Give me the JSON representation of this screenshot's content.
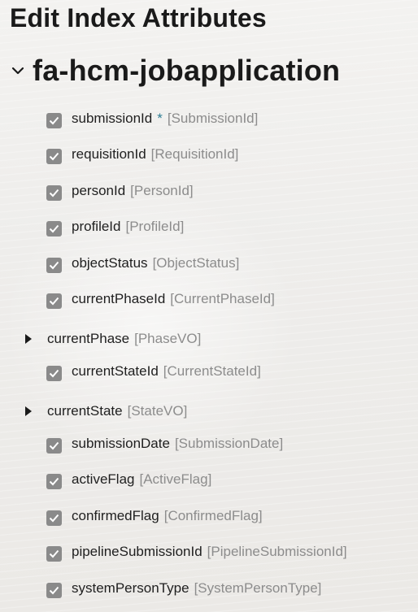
{
  "page": {
    "title": "Edit Index Attributes"
  },
  "group": {
    "name": "fa-hcm-jobapplication",
    "expanded": true
  },
  "colors": {
    "checkbox_fill": "#8a8a8a",
    "required_marker": "#2d7d93",
    "type_text": "#8c8c8c"
  },
  "attributes": [
    {
      "name": "submissionId",
      "required_mark": "*",
      "type": "[SubmissionId]",
      "checked": true
    },
    {
      "name": "requisitionId",
      "type": "[RequisitionId]",
      "checked": true
    },
    {
      "name": "personId",
      "type": "[PersonId]",
      "checked": true
    },
    {
      "name": "profileId",
      "type": "[ProfileId]",
      "checked": true
    },
    {
      "name": "objectStatus",
      "type": "[ObjectStatus]",
      "checked": true
    },
    {
      "name": "currentPhaseId",
      "type": "[CurrentPhaseId]",
      "checked": true
    },
    {
      "name": "currentStateId",
      "type": "[CurrentStateId]",
      "checked": true
    },
    {
      "name": "submissionDate",
      "type": "[SubmissionDate]",
      "checked": true
    },
    {
      "name": "activeFlag",
      "type": "[ActiveFlag]",
      "checked": true
    },
    {
      "name": "confirmedFlag",
      "type": "[ConfirmedFlag]",
      "checked": true
    },
    {
      "name": "pipelineSubmissionId",
      "type": "[PipelineSubmissionId]",
      "checked": true
    },
    {
      "name": "systemPersonType",
      "type": "[SystemPersonType]",
      "checked": true
    }
  ],
  "nodes": [
    {
      "name": "currentPhase",
      "type": "[PhaseVO]",
      "expanded": false
    },
    {
      "name": "currentState",
      "type": "[StateVO]",
      "expanded": false
    }
  ]
}
